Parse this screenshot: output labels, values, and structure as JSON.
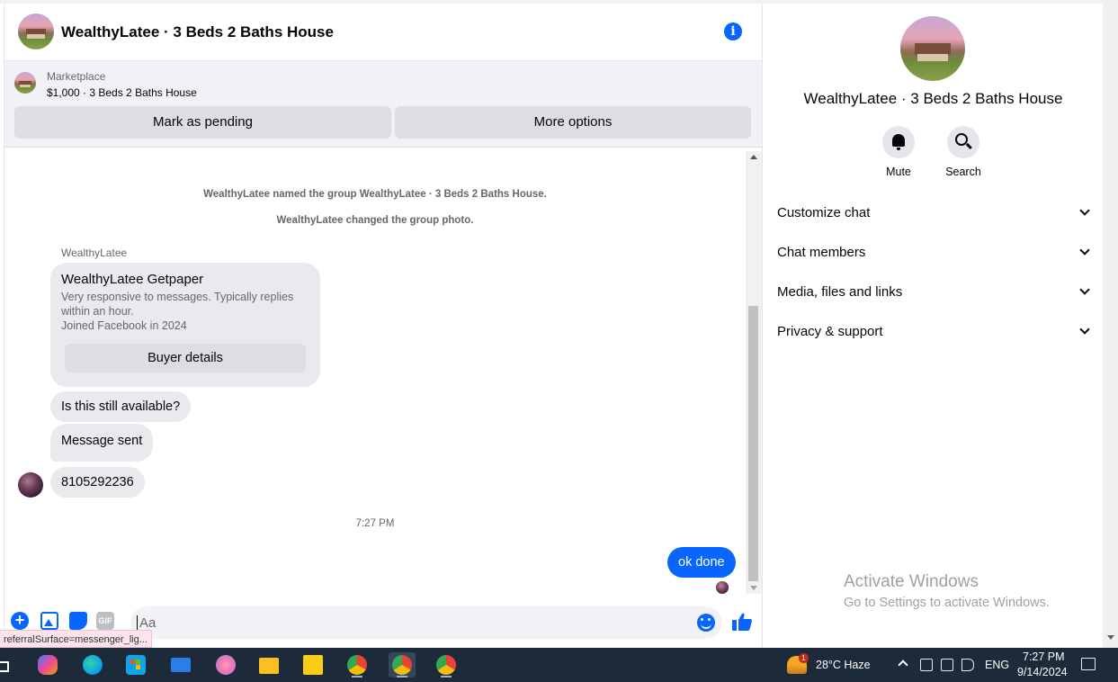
{
  "header": {
    "title": "WealthyLatee · 3 Beds 2 Baths House",
    "info_icon": "info-icon"
  },
  "marketplace": {
    "label": "Marketplace",
    "listing": "$1,000 · 3 Beds 2 Baths House",
    "pending_label": "Mark as pending",
    "more_label": "More options"
  },
  "messages": {
    "system": [
      "WealthyLatee named the group WealthyLatee · 3 Beds 2 Baths House.",
      "WealthyLatee changed the group photo."
    ],
    "sender": "WealthyLatee",
    "card": {
      "title": "WealthyLatee Getpaper",
      "desc1": "Very responsive to messages. Typically replies within an hour.",
      "desc2": "Joined Facebook in 2024",
      "button": "Buyer details"
    },
    "incoming": [
      "Is this still available?",
      "Message sent",
      "8105292236"
    ],
    "timestamp": "7:27 PM",
    "outgoing": "ok done"
  },
  "composer": {
    "placeholder": "Aa",
    "gif_label": "GIF"
  },
  "status_url": "referralSurface=messenger_lig...",
  "side": {
    "title": "WealthyLatee · 3 Beds 2 Baths House",
    "mute_label": "Mute",
    "search_label": "Search",
    "rows": [
      "Customize chat",
      "Chat members",
      "Media, files and links",
      "Privacy & support"
    ]
  },
  "watermark": {
    "line1": "Activate Windows",
    "line2": "Go to Settings to activate Windows."
  },
  "taskbar": {
    "weather": "28°C  Haze",
    "weather_badge": "1",
    "lang": "ENG",
    "time": "7:27 PM",
    "date": "9/14/2024"
  },
  "colors": {
    "accent": "#0866ff",
    "taskbar": "#1c2a3a"
  }
}
